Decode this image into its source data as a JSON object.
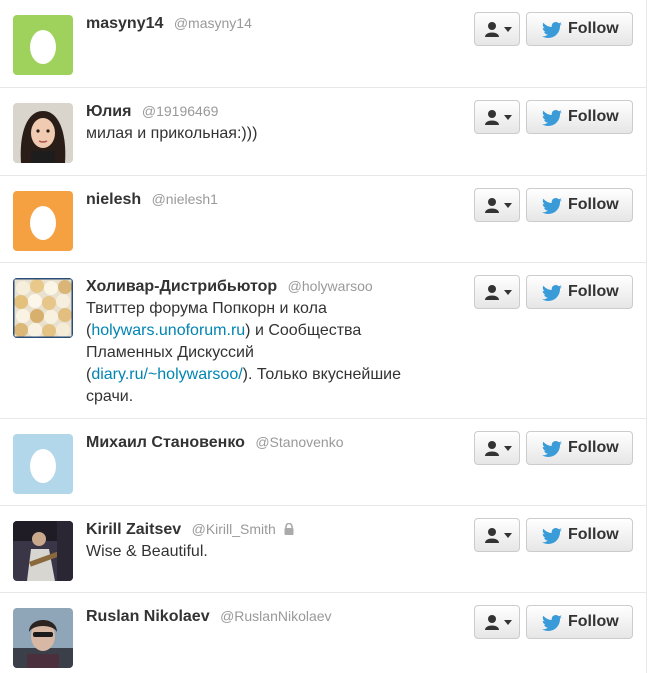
{
  "follow_label": "Follow",
  "colors": {
    "link": "#0084b4",
    "handle": "#999999",
    "egg_green": "#9ed25c",
    "egg_orange": "#f5a041",
    "egg_blue": "#b3d7ea"
  },
  "users": [
    {
      "name": "masyny14",
      "handle": "@masyny14",
      "avatar": "egg-avatar-green",
      "bio": []
    },
    {
      "name": "Юлия",
      "handle": "@19196469",
      "avatar": "photo-avatar-girl",
      "bio": [
        "милая и прикольная:)))"
      ]
    },
    {
      "name": "nielesh",
      "handle": "@nielesh1",
      "avatar": "egg-avatar-orange",
      "bio": []
    },
    {
      "name": "Холивар-Дистрибьютор",
      "handle": "@holywarsoo",
      "avatar": "photo-avatar-popcorn",
      "bio": [
        "Твиттер форума Попкорн и кола",
        "(",
        "holywars.unoforum.ru",
        ") и Сообщества",
        "Пламенных Дискуссий",
        "(",
        "diary.ru/~holywarsoo/",
        "). Только вкуснейшие",
        "срачи."
      ]
    },
    {
      "name": "Михаил Становенко",
      "handle": "@Stanovenko",
      "avatar": "egg-avatar-blue",
      "bio": []
    },
    {
      "name": "Kirill Zaitsev",
      "handle": "@Kirill_Smith",
      "avatar": "photo-avatar-guitarist",
      "protected": true,
      "bio": [
        "Wise & Beautiful."
      ]
    },
    {
      "name": "Ruslan Nikolaev",
      "handle": "@RuslanNikolaev",
      "avatar": "photo-avatar-man",
      "bio": []
    }
  ]
}
